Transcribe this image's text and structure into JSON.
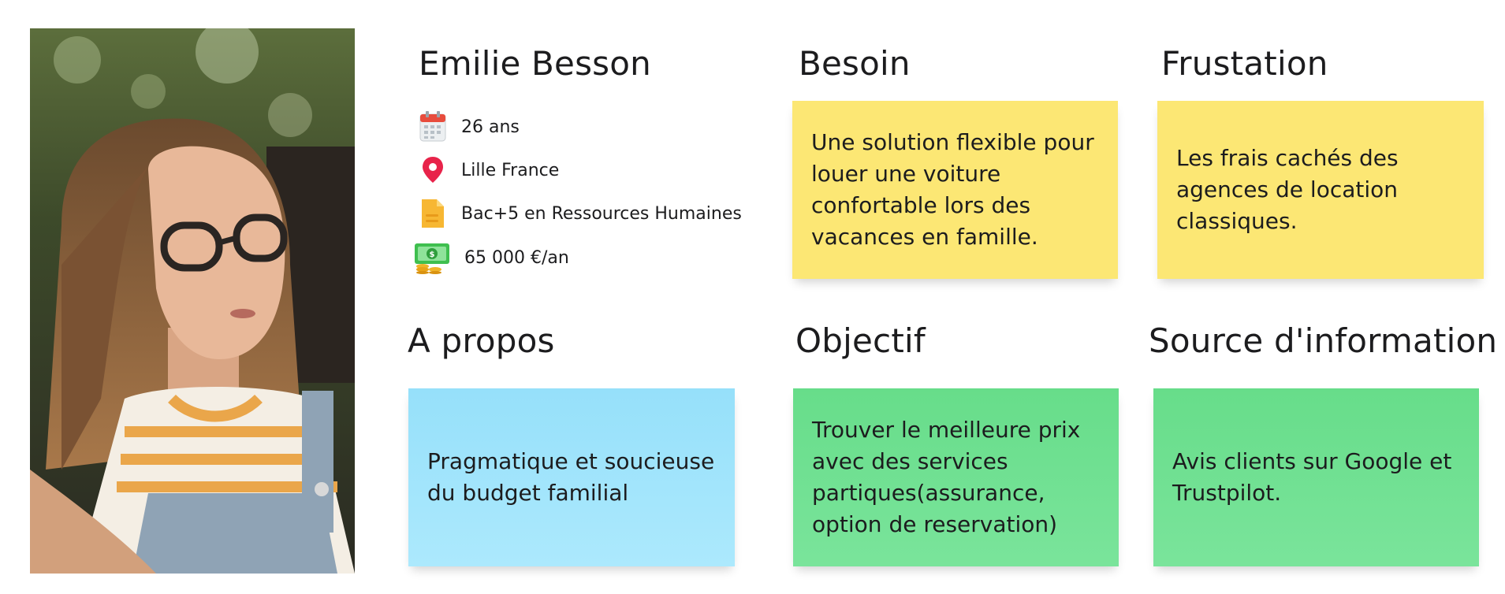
{
  "persona": {
    "name": "Emilie Besson",
    "age": "26 ans",
    "location": "Lille France",
    "education": "Bac+5 en Ressources Humaines",
    "income": "65 000 €/an",
    "icons": {
      "age": "calendar-icon",
      "location": "map-pin-icon",
      "education": "document-icon",
      "income": "money-icon"
    }
  },
  "sections": {
    "besoin": {
      "title": "Besoin",
      "text": "Une solution flexible pour louer une voiture confortable lors des vacances en famille."
    },
    "frustation": {
      "title": "Frustation",
      "text": "Les frais cachés des agences de location classiques."
    },
    "a_propos": {
      "title": "A propos",
      "text": "Pragmatique et soucieuse du budget familial"
    },
    "objectif": {
      "title": "Objectif",
      "text": "Trouver le meilleure prix avec des services partiques(assurance, option de reservation)"
    },
    "source": {
      "title": "Source d'information",
      "text": "Avis clients sur Google et Trustpilot."
    }
  },
  "colors": {
    "yellow": "#fce774",
    "blue": "#a0e4fb",
    "green": "#6fe092",
    "pin": "#e8234a"
  }
}
